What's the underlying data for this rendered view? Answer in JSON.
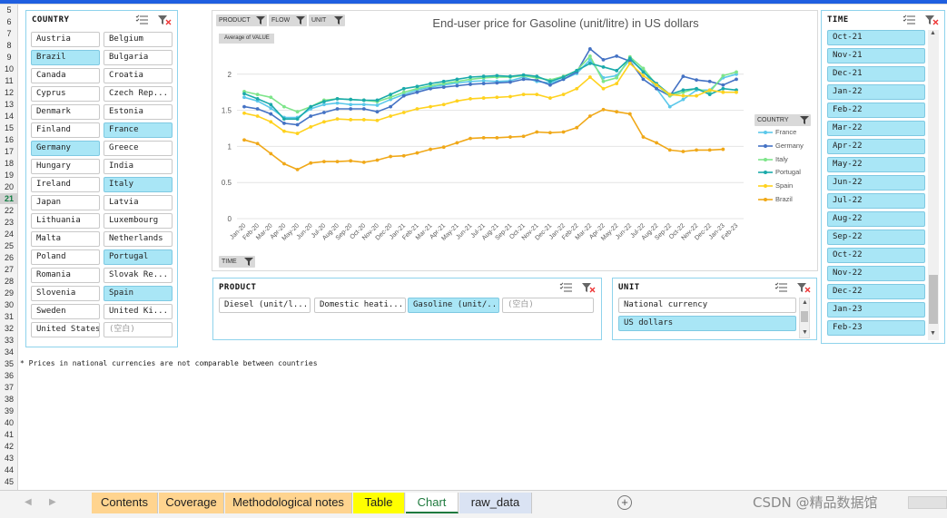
{
  "rows": [
    "5",
    "6",
    "7",
    "8",
    "9",
    "10",
    "11",
    "12",
    "13",
    "14",
    "15",
    "16",
    "17",
    "18",
    "19",
    "20",
    "21",
    "22",
    "23",
    "24",
    "25",
    "26",
    "27",
    "28",
    "29",
    "30",
    "31",
    "32",
    "33",
    "34",
    "35",
    "36",
    "37",
    "38",
    "39",
    "40",
    "41",
    "42",
    "43",
    "44",
    "45"
  ],
  "selected_row": "21",
  "country_slicer": {
    "title": "COUNTRY",
    "items": [
      {
        "label": "Austria",
        "selected": false
      },
      {
        "label": "Belgium",
        "selected": false
      },
      {
        "label": "Brazil",
        "selected": true
      },
      {
        "label": "Bulgaria",
        "selected": false
      },
      {
        "label": "Canada",
        "selected": false
      },
      {
        "label": "Croatia",
        "selected": false
      },
      {
        "label": "Cyprus",
        "selected": false
      },
      {
        "label": "Czech Rep...",
        "selected": false
      },
      {
        "label": "Denmark",
        "selected": false
      },
      {
        "label": "Estonia",
        "selected": false
      },
      {
        "label": "Finland",
        "selected": false
      },
      {
        "label": "France",
        "selected": true
      },
      {
        "label": "Germany",
        "selected": true
      },
      {
        "label": "Greece",
        "selected": false
      },
      {
        "label": "Hungary",
        "selected": false
      },
      {
        "label": "India",
        "selected": false
      },
      {
        "label": "Ireland",
        "selected": false
      },
      {
        "label": "Italy",
        "selected": true
      },
      {
        "label": "Japan",
        "selected": false
      },
      {
        "label": "Latvia",
        "selected": false
      },
      {
        "label": "Lithuania",
        "selected": false
      },
      {
        "label": "Luxembourg",
        "selected": false
      },
      {
        "label": "Malta",
        "selected": false
      },
      {
        "label": "Netherlands",
        "selected": false
      },
      {
        "label": "Poland",
        "selected": false
      },
      {
        "label": "Portugal",
        "selected": true
      },
      {
        "label": "Romania",
        "selected": false
      },
      {
        "label": "Slovak Re...",
        "selected": false
      },
      {
        "label": "Slovenia",
        "selected": false
      },
      {
        "label": "Spain",
        "selected": true
      },
      {
        "label": "Sweden",
        "selected": false
      },
      {
        "label": "United Ki...",
        "selected": false
      },
      {
        "label": "United States",
        "selected": false
      },
      {
        "label": "(空白)",
        "selected": false,
        "blank": true
      }
    ]
  },
  "product_slicer": {
    "title": "PRODUCT",
    "items": [
      {
        "label": "Diesel (unit/l...",
        "selected": false
      },
      {
        "label": "Domestic heati...",
        "selected": false
      },
      {
        "label": "Gasoline (unit/...",
        "selected": true
      },
      {
        "label": "(空白)",
        "selected": false,
        "blank": true
      }
    ]
  },
  "unit_slicer": {
    "title": "UNIT",
    "items": [
      {
        "label": "National currency",
        "selected": false
      },
      {
        "label": "US dollars",
        "selected": true
      }
    ]
  },
  "time_slicer": {
    "title": "TIME",
    "items": [
      "Oct-21",
      "Nov-21",
      "Dec-21",
      "Jan-22",
      "Feb-22",
      "Mar-22",
      "Apr-22",
      "May-22",
      "Jun-22",
      "Jul-22",
      "Aug-22",
      "Sep-22",
      "Oct-22",
      "Nov-22",
      "Dec-22",
      "Jan-23",
      "Feb-23"
    ]
  },
  "chart_buttons": {
    "product": "PRODUCT",
    "flow": "FLOW",
    "unit": "UNIT",
    "time": "TIME",
    "country": "COUNTRY",
    "avg": "Average of VALUE"
  },
  "chart_data": {
    "type": "line",
    "title": "End-user price for Gasoline (unit/litre) in US dollars",
    "xlabel": "",
    "ylabel": "",
    "ylim": [
      0,
      2.5
    ],
    "yticks": [
      0,
      0.5,
      1,
      1.5,
      2
    ],
    "legend_position": "right",
    "grid": true,
    "x": [
      "Jan-20",
      "Feb-20",
      "Mar-20",
      "Apr-20",
      "May-20",
      "Jun-20",
      "Jul-20",
      "Aug-20",
      "Sep-20",
      "Oct-20",
      "Nov-20",
      "Dec-20",
      "Jan-21",
      "Feb-21",
      "Mar-21",
      "Apr-21",
      "May-21",
      "Jun-21",
      "Jul-21",
      "Aug-21",
      "Sep-21",
      "Oct-21",
      "Nov-21",
      "Dec-21",
      "Jan-22",
      "Feb-22",
      "Mar-22",
      "Apr-22",
      "May-22",
      "Jun-22",
      "Jul-22",
      "Aug-22",
      "Sep-22",
      "Oct-22",
      "Nov-22",
      "Dec-22",
      "Jan-23",
      "Feb-23"
    ],
    "series": [
      {
        "name": "France",
        "color": "#5bc8ea",
        "values": [
          1.68,
          1.63,
          1.53,
          1.4,
          1.4,
          1.52,
          1.58,
          1.6,
          1.58,
          1.58,
          1.57,
          1.65,
          1.72,
          1.78,
          1.82,
          1.85,
          1.88,
          1.9,
          1.91,
          1.9,
          1.91,
          1.96,
          1.9,
          1.88,
          1.93,
          2.01,
          2.2,
          1.95,
          1.98,
          2.2,
          2.05,
          1.8,
          1.55,
          1.65,
          1.78,
          1.78,
          1.95,
          2.0
        ]
      },
      {
        "name": "Germany",
        "color": "#4472c4",
        "values": [
          1.55,
          1.52,
          1.45,
          1.32,
          1.3,
          1.42,
          1.47,
          1.52,
          1.52,
          1.52,
          1.48,
          1.55,
          1.7,
          1.75,
          1.8,
          1.82,
          1.84,
          1.86,
          1.87,
          1.88,
          1.89,
          1.93,
          1.92,
          1.85,
          1.93,
          2.03,
          2.35,
          2.2,
          2.25,
          2.18,
          1.93,
          1.8,
          1.7,
          1.97,
          1.92,
          1.9,
          1.85,
          1.93
        ]
      },
      {
        "name": "Italy",
        "color": "#7ee58a",
        "values": [
          1.76,
          1.72,
          1.68,
          1.55,
          1.48,
          1.55,
          1.64,
          1.66,
          1.65,
          1.64,
          1.62,
          1.68,
          1.75,
          1.8,
          1.84,
          1.87,
          1.9,
          1.93,
          1.95,
          1.96,
          1.96,
          1.98,
          1.95,
          1.92,
          1.97,
          2.05,
          2.25,
          1.9,
          1.95,
          2.24,
          2.08,
          1.85,
          1.7,
          1.75,
          1.8,
          1.75,
          1.98,
          2.03
        ]
      },
      {
        "name": "Portugal",
        "color": "#1aaaaa",
        "values": [
          1.73,
          1.66,
          1.58,
          1.38,
          1.38,
          1.55,
          1.62,
          1.66,
          1.65,
          1.64,
          1.64,
          1.72,
          1.8,
          1.83,
          1.87,
          1.9,
          1.93,
          1.96,
          1.97,
          1.98,
          1.97,
          1.99,
          1.97,
          1.9,
          1.96,
          2.05,
          2.15,
          2.1,
          2.05,
          2.22,
          2.03,
          1.87,
          1.72,
          1.78,
          1.8,
          1.72,
          1.8,
          1.78
        ]
      },
      {
        "name": "Spain",
        "color": "#ffd21e",
        "values": [
          1.46,
          1.42,
          1.34,
          1.21,
          1.18,
          1.27,
          1.34,
          1.38,
          1.37,
          1.37,
          1.36,
          1.42,
          1.47,
          1.52,
          1.55,
          1.58,
          1.63,
          1.66,
          1.67,
          1.68,
          1.69,
          1.72,
          1.72,
          1.67,
          1.72,
          1.8,
          1.96,
          1.8,
          1.87,
          2.15,
          1.98,
          1.85,
          1.72,
          1.7,
          1.7,
          1.78,
          1.75,
          1.75
        ]
      },
      {
        "name": "Brazil",
        "color": "#f0a818",
        "values": [
          1.09,
          1.04,
          0.9,
          0.76,
          0.68,
          0.77,
          0.79,
          0.79,
          0.8,
          0.78,
          0.81,
          0.86,
          0.87,
          0.91,
          0.96,
          0.99,
          1.05,
          1.11,
          1.12,
          1.12,
          1.13,
          1.14,
          1.2,
          1.19,
          1.2,
          1.26,
          1.42,
          1.51,
          1.48,
          1.45,
          1.13,
          1.05,
          0.95,
          0.93,
          0.95,
          0.95,
          0.96,
          null
        ]
      }
    ]
  },
  "footnote": "* Prices in national currencies are not comparable between countries",
  "tabs": [
    {
      "label": "Contents",
      "bg": "#ffd48f"
    },
    {
      "label": "Coverage",
      "bg": "#ffd48f"
    },
    {
      "label": "Methodological notes",
      "bg": "#ffd48f"
    },
    {
      "label": "Table",
      "bg": "#ffff00"
    },
    {
      "label": "Chart",
      "bg": "#ffffff",
      "active": true
    },
    {
      "label": "raw_data",
      "bg": "#dae3f3"
    }
  ],
  "watermark": "CSDN @精品数据馆"
}
